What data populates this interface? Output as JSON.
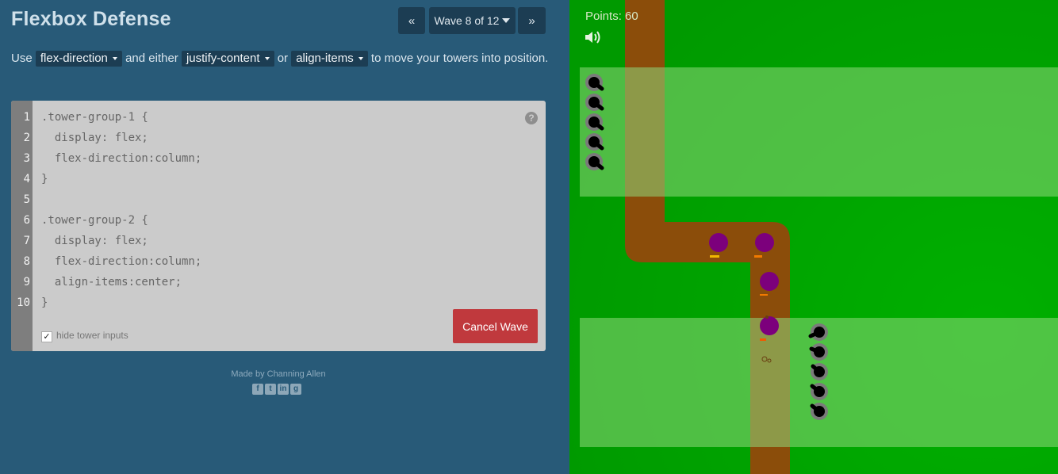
{
  "header": {
    "title": "Flexbox Defense",
    "prev_icon": "«",
    "next_icon": "»",
    "wave_label": "Wave 8 of 12"
  },
  "instructions": {
    "prefix": "Use",
    "dd1": "flex-direction",
    "mid1": "and either",
    "dd2": "justify-content",
    "mid2": "or",
    "dd3": "align-items",
    "suffix": "to move your towers into position."
  },
  "editor": {
    "line_numbers": [
      "1",
      "2",
      "3",
      "4",
      "5",
      "6",
      "7",
      "8",
      "9",
      "10"
    ],
    "lines": [
      ".tower-group-1 {",
      "  display: flex;",
      "  flex-direction:column;",
      "}",
      "",
      ".tower-group-2 {",
      "  display: flex;",
      "  flex-direction:column;",
      "  align-items:center;",
      "}"
    ],
    "help_icon": "?",
    "hide_inputs_label": "hide tower inputs",
    "hide_inputs_checked": true,
    "cancel_label": "Cancel Wave"
  },
  "footer": {
    "credit": "Made by Channing Allen",
    "social_icons": [
      "facebook-icon",
      "twitter-icon",
      "linkedin-icon",
      "github-icon"
    ]
  },
  "game": {
    "points_label": "Points: 60",
    "sound_icon": "speaker-icon",
    "colors": {
      "grass": "#00a400",
      "path": "#8b4d0a",
      "zone": "#7bd16b",
      "enemy": "#7c007c"
    }
  }
}
